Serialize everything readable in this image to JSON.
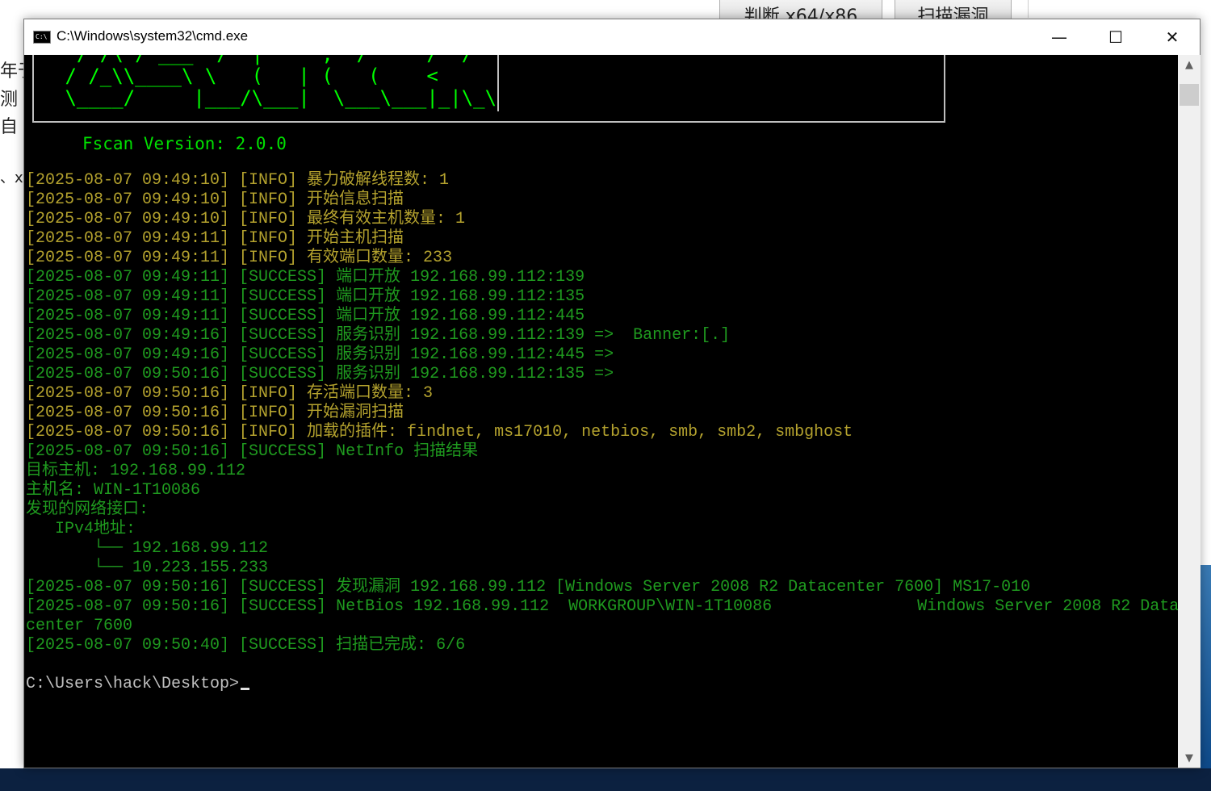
{
  "background": {
    "buttons": [
      "判断 x64/x86",
      "扫描漏洞"
    ],
    "text_fragments": [
      "年于",
      "测",
      "自",
      "、x"
    ]
  },
  "window": {
    "title": "C:\\Windows\\system32\\cmd.exe",
    "icon_label": "C:\\",
    "minimize": "—",
    "maximize": "☐",
    "close": "✕"
  },
  "console": {
    "banner_art": "  / /\\ / ___  /  |     ,  /  `  /  /\n / /_\\\\____\\ \\   (   | (   (    <\n \\____/     |___/\\___|  \\___\\___|_|\\_\\",
    "version": "Fscan Version: 2.0.0",
    "lines": [
      {
        "level": "info",
        "text": "[2025-08-07 09:49:10] [INFO] 暴力破解线程数: 1"
      },
      {
        "level": "info",
        "text": "[2025-08-07 09:49:10] [INFO] 开始信息扫描"
      },
      {
        "level": "info",
        "text": "[2025-08-07 09:49:10] [INFO] 最终有效主机数量: 1"
      },
      {
        "level": "info",
        "text": "[2025-08-07 09:49:11] [INFO] 开始主机扫描"
      },
      {
        "level": "info",
        "text": "[2025-08-07 09:49:11] [INFO] 有效端口数量: 233"
      },
      {
        "level": "success",
        "text": "[2025-08-07 09:49:11] [SUCCESS] 端口开放 192.168.99.112:139"
      },
      {
        "level": "success",
        "text": "[2025-08-07 09:49:11] [SUCCESS] 端口开放 192.168.99.112:135"
      },
      {
        "level": "success",
        "text": "[2025-08-07 09:49:11] [SUCCESS] 端口开放 192.168.99.112:445"
      },
      {
        "level": "success",
        "text": "[2025-08-07 09:49:16] [SUCCESS] 服务识别 192.168.99.112:139 =>  Banner:[.]"
      },
      {
        "level": "success",
        "text": "[2025-08-07 09:49:16] [SUCCESS] 服务识别 192.168.99.112:445 =>"
      },
      {
        "level": "success",
        "text": "[2025-08-07 09:50:16] [SUCCESS] 服务识别 192.168.99.112:135 =>"
      },
      {
        "level": "info",
        "text": "[2025-08-07 09:50:16] [INFO] 存活端口数量: 3"
      },
      {
        "level": "info",
        "text": "[2025-08-07 09:50:16] [INFO] 开始漏洞扫描"
      },
      {
        "level": "info",
        "text": "[2025-08-07 09:50:16] [INFO] 加载的插件: findnet, ms17010, netbios, smb, smb2, smbghost"
      },
      {
        "level": "success",
        "text": "[2025-08-07 09:50:16] [SUCCESS] NetInfo 扫描结果"
      },
      {
        "level": "plain",
        "text": "目标主机: 192.168.99.112"
      },
      {
        "level": "plain",
        "text": "主机名: WIN-1T10086"
      },
      {
        "level": "plain",
        "text": "发现的网络接口:"
      },
      {
        "level": "plain",
        "text": "   IPv4地址:"
      },
      {
        "level": "tree",
        "text": "       └── 192.168.99.112"
      },
      {
        "level": "tree",
        "text": "       └── 10.223.155.233"
      },
      {
        "level": "success",
        "text": "[2025-08-07 09:50:16] [SUCCESS] 发现漏洞 192.168.99.112 [Windows Server 2008 R2 Datacenter 7600] MS17-010"
      },
      {
        "level": "success",
        "text": "[2025-08-07 09:50:16] [SUCCESS] NetBios 192.168.99.112  WORKGROUP\\WIN-1T10086               Windows Server 2008 R2 Data"
      },
      {
        "level": "success",
        "text": "center 7600"
      },
      {
        "level": "success",
        "text": "[2025-08-07 09:50:40] [SUCCESS] 扫描已完成: 6/6"
      },
      {
        "level": "blank",
        "text": ""
      },
      {
        "level": "prompt",
        "text": "C:\\Users\\hack\\Desktop>"
      }
    ]
  },
  "scrollbar": {
    "up": "▲",
    "down": "▼"
  },
  "colors": {
    "info": "#b4a22e",
    "success": "#1f9a1f",
    "banner": "#00ff00",
    "console_bg": "#000000"
  }
}
